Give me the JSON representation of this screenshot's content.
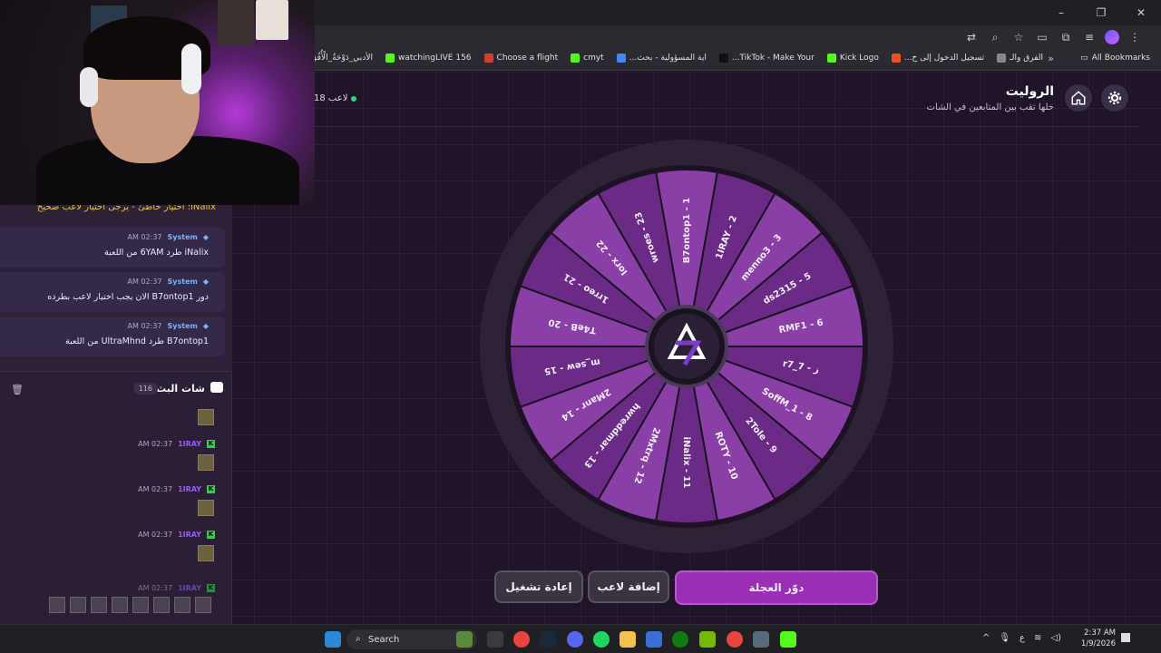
{
  "browser": {
    "bookmarks": [
      {
        "label": "الفرق والـ",
        "color": "#888888"
      },
      {
        "label": "تسجيل الدخول إلى ح...",
        "color": "#f25022"
      },
      {
        "label": "Kick Logo",
        "color": "#53fc18"
      },
      {
        "label": "TikTok - Make Your...",
        "color": "#111111"
      },
      {
        "label": "اية المسؤولية - بحث...",
        "color": "#4285f4"
      },
      {
        "label": "cmyt",
        "color": "#53fc18"
      },
      {
        "label": "Choose a flight",
        "color": "#d0402a"
      },
      {
        "label": "156 watchingLIVE",
        "color": "#53fc18"
      },
      {
        "label": "الأدبي_دَوْحَةُ_الْأُفُقِ_ال...",
        "color": "#888888"
      }
    ],
    "all_bookmarks": "All Bookmarks",
    "more_bookmarks": "»"
  },
  "header": {
    "title": "الروليت",
    "subtitle": "خلها تقب بين المتابعين في الشات",
    "players": "18 لاعب"
  },
  "wheel": {
    "segments": [
      "B7ontop1 - 1",
      "1IRAY - 2",
      "menno3 - 3",
      "ds2315 - 5",
      "RMF1 - 6",
      "r7_ز - 7",
      "SoffM_1 - 8",
      "2Tole - 9",
      "ROTY - 10",
      "iNalix - 11",
      "2Mxtrq - 12",
      "hwreddmar - 13",
      "2Manr - 14",
      "m_sew - 15",
      "T4eB - 20",
      "1rreo - 21",
      "Iorx - 22",
      "wroes - 23"
    ],
    "colors": [
      "#8a3fa6",
      "#6b2a85"
    ]
  },
  "buttons": {
    "spin": "دوّر العجلة",
    "add": "إضافة لاعب",
    "restart": "إعادة تشغيل"
  },
  "system_messages": {
    "top": "iNalix: اختيار خاطئ - يرجى اختيار لاعب صحيح",
    "items": [
      {
        "name": "System",
        "time": "02:37 AM",
        "text": "iNalix طرد 6YAM من اللعبة"
      },
      {
        "name": "System",
        "time": "02:37 AM",
        "text": "دور B7ontop1 الان يجب اختيار لاعب بطرده"
      },
      {
        "name": "System",
        "time": "02:37 AM",
        "text": "B7ontop1 طرد UltraMhnd من اللعبة"
      }
    ]
  },
  "stream_chat": {
    "title": "شات البث",
    "count": "116",
    "messages": [
      {
        "user": "1IRAY",
        "time": "02:37 AM"
      },
      {
        "user": "1IRAY",
        "time": "02:37 AM"
      },
      {
        "user": "1IRAY",
        "time": "02:37 AM"
      },
      {
        "user": "1IRAY",
        "time": "02:37 AM"
      }
    ]
  },
  "taskbar": {
    "search": "Search",
    "time": "2:37 AM",
    "date": "1/9/2026",
    "lang": "ع"
  }
}
